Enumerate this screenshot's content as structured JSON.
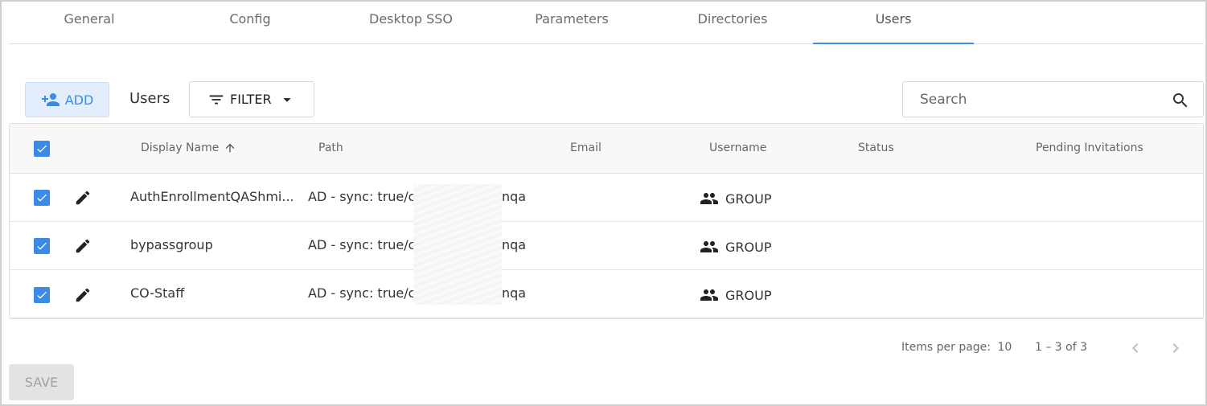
{
  "tabs": [
    {
      "label": "General"
    },
    {
      "label": "Config"
    },
    {
      "label": "Desktop SSO"
    },
    {
      "label": "Parameters"
    },
    {
      "label": "Directories"
    },
    {
      "label": "Users"
    }
  ],
  "active_tab": "Users",
  "accent_color": "#3d8ee6",
  "toolbar": {
    "add_label": "ADD",
    "title": "Users",
    "filter_label": "FILTER",
    "search_placeholder": "Search"
  },
  "table": {
    "headers": {
      "display_name": "Display Name",
      "path": "Path",
      "email": "Email",
      "username": "Username",
      "status": "Status",
      "pending_invitations": "Pending Invitations"
    },
    "sort_icon": "arrow-up-icon",
    "rows": [
      {
        "display_name": "AuthEnrollmentQAShmi...",
        "path_start": "AD - sync: true/co",
        "path_end": "nqa",
        "email": "",
        "username": "GROUP",
        "status": "",
        "pending": "",
        "checked": true
      },
      {
        "display_name": "bypassgroup",
        "path_start": "AD - sync: true/co",
        "path_end": "nqa",
        "email": "",
        "username": "GROUP",
        "status": "",
        "pending": "",
        "checked": true
      },
      {
        "display_name": "CO-Staff",
        "path_start": "AD - sync: true/co",
        "path_end": "nqa",
        "email": "",
        "username": "GROUP",
        "status": "",
        "pending": "",
        "checked": true
      }
    ]
  },
  "pagination": {
    "items_per_page_label": "Items per page:",
    "items_per_page": "10",
    "range": "1 – 3 of 3"
  },
  "save_label": "SAVE"
}
